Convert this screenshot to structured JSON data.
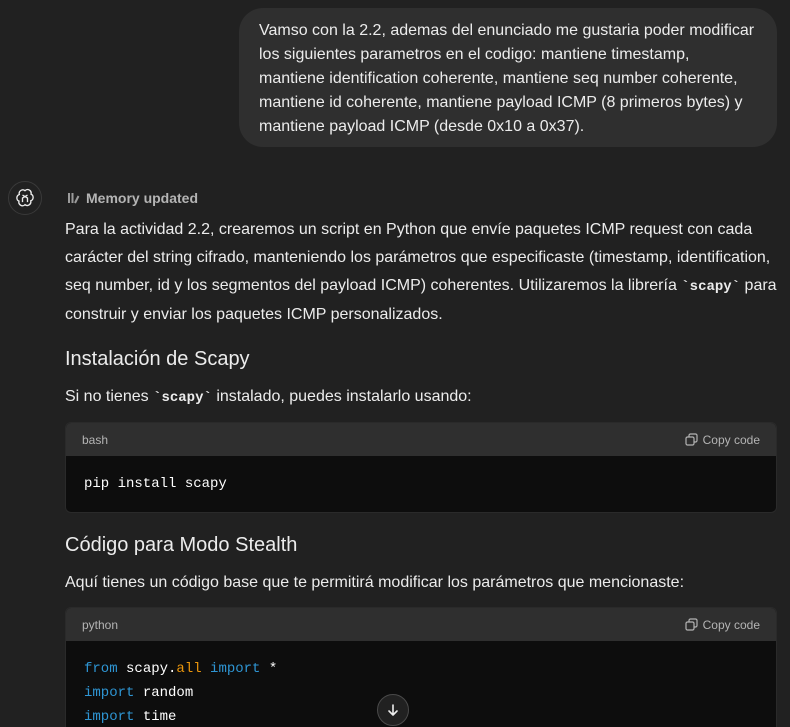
{
  "user_message": "Vamso con la 2.2, ademas del enunciado me gustaria poder modificar los siguientes parametros en el codigo: mantiene timestamp, mantiene identification coherente, mantiene seq number coherente, mantiene id coherente, mantiene payload ICMP (8 primeros bytes) y mantiene payload ICMP (desde 0x10 a 0x37).",
  "memory_label": "Memory updated",
  "intro": {
    "before": "Para la actividad 2.2, crearemos un script en Python que envíe paquetes ICMP request con cada carácter del string cifrado, manteniendo los parámetros que especificaste (timestamp, identification, seq number, id y los segmentos del payload ICMP) coherentes. Utilizaremos la librería ",
    "code": "`scapy`",
    "after": " para construir y enviar los paquetes ICMP personalizados."
  },
  "section1": {
    "heading": "Instalación de Scapy",
    "text_before": "Si no tienes ",
    "text_code": "`scapy`",
    "text_after": " instalado, puedes instalarlo usando:",
    "code_lang": "bash",
    "code": "pip install scapy"
  },
  "section2": {
    "heading": "Código para Modo Stealth",
    "text": "Aquí tienes un código base que te permitirá modificar los parámetros que mencionaste:",
    "code_lang": "python",
    "code_lines": [
      {
        "kw": "from",
        "mod": " scapy.",
        "attr": "all",
        "kw2": " import",
        "rest": " *"
      },
      {
        "kw": "import",
        "rest": " random"
      },
      {
        "kw": "import",
        "rest": " time"
      }
    ]
  },
  "copy_label": "Copy code",
  "icons": [
    "openai-logo-icon",
    "memory-icon",
    "copy-icon",
    "arrow-down-icon"
  ]
}
